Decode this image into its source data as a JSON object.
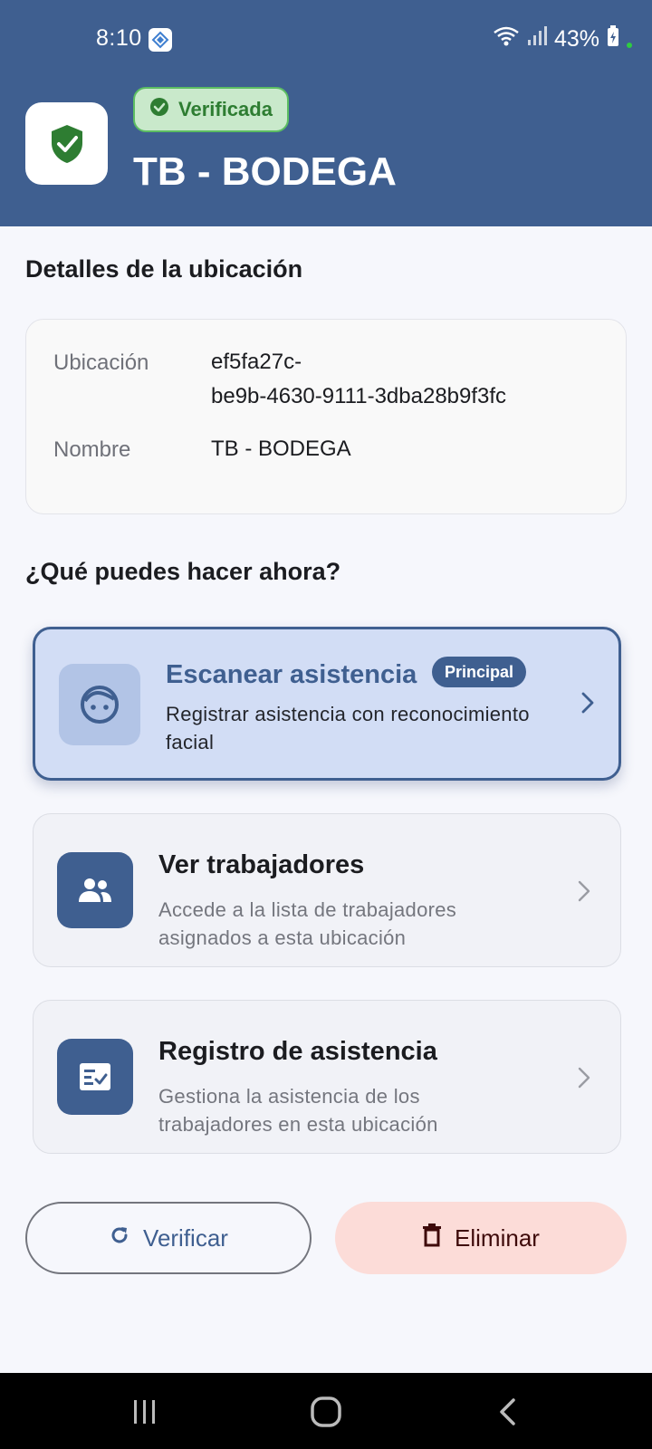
{
  "status_bar": {
    "time": "8:10",
    "battery": "43%",
    "icons": [
      "app-notification-icon",
      "wifi-icon",
      "signal-icon",
      "battery-charging-icon"
    ]
  },
  "header": {
    "badge_label": "Verificada",
    "title": "TB - BODEGA",
    "shield_icon": "shield-check-icon"
  },
  "details": {
    "section_title": "Detalles de la ubicación",
    "rows": [
      {
        "label": "Ubicación",
        "value_line1": "ef5fa27c-",
        "value_line2": "be9b-4630-9111-3dba28b9f3fc"
      },
      {
        "label": "Nombre",
        "value": "TB - BODEGA"
      }
    ]
  },
  "actions": {
    "section_title": "¿Qué puedes hacer ahora?",
    "items": [
      {
        "title": "Escanear asistencia",
        "badge": "Principal",
        "description": "Registrar asistencia con reconocimiento facial",
        "icon": "face-icon"
      },
      {
        "title": "Ver trabajadores",
        "description": "Accede a la lista de trabajadores asignados a esta ubicación",
        "icon": "people-icon"
      },
      {
        "title": "Registro de asistencia",
        "description": "Gestiona la asistencia de los trabajadores en esta ubicación",
        "icon": "checklist-icon"
      }
    ]
  },
  "buttons": {
    "verify": "Verificar",
    "delete": "Eliminar"
  },
  "colors": {
    "primary": "#3f5f90",
    "success": "#2e7d32",
    "danger_bg": "#fcdcd8"
  }
}
